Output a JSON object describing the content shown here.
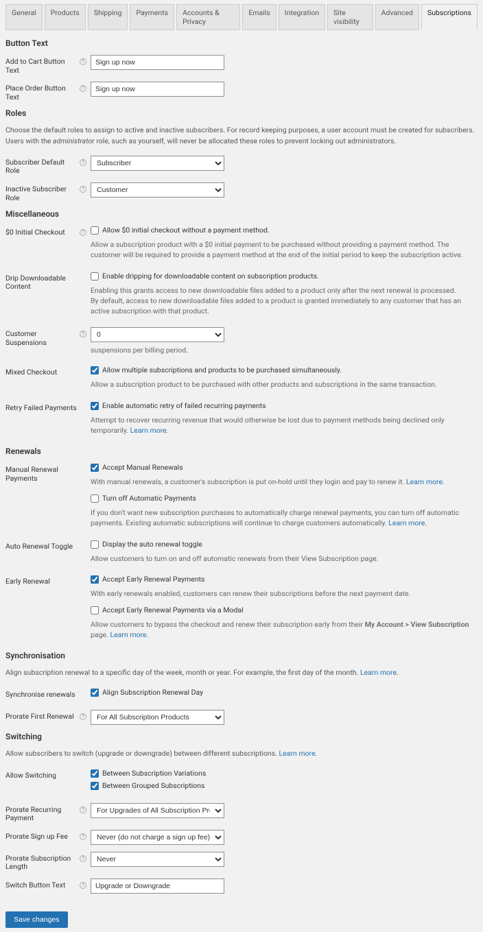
{
  "tabs": [
    "General",
    "Products",
    "Shipping",
    "Payments",
    "Accounts & Privacy",
    "Emails",
    "Integration",
    "Site visibility",
    "Advanced",
    "Subscriptions"
  ],
  "activeTab": "Subscriptions",
  "sections": {
    "buttonText": {
      "title": "Button Text",
      "addToCart": {
        "label": "Add to Cart Button Text",
        "value": "Sign up now"
      },
      "placeOrder": {
        "label": "Place Order Button Text",
        "value": "Sign up now"
      }
    },
    "roles": {
      "title": "Roles",
      "desc_a": "Choose the default roles to assign to active and inactive subscribers. For record keeping purposes, a user account must be created for subscribers. Users with the ",
      "desc_bold": "administrator",
      "desc_b": " role, such as yourself, will never be allocated these roles to prevent locking out administrators.",
      "defaultRole": {
        "label": "Subscriber Default Role",
        "value": "Subscriber"
      },
      "inactiveRole": {
        "label": "Inactive Subscriber Role",
        "value": "Customer"
      }
    },
    "misc": {
      "title": "Miscellaneous",
      "zeroInitial": {
        "label": "$0 Initial Checkout",
        "checkbox": "Allow $0 initial checkout without a payment method.",
        "help": "Allow a subscription product with a $0 initial payment to be purchased without providing a payment method. The customer will be required to provide a payment method at the end of the initial period to keep the subscription active."
      },
      "drip": {
        "label": "Drip Downloadable Content",
        "checkbox": "Enable dripping for downloadable content on subscription products.",
        "help1": "Enabling this grants access to new downloadable files added to a product only after the next renewal is processed.",
        "help2": "By default, access to new downloadable files added to a product is granted immediately to any customer that has an active subscription with that product."
      },
      "suspensions": {
        "label": "Customer Suspensions",
        "value": "0",
        "help": "suspensions per billing period."
      },
      "mixed": {
        "label": "Mixed Checkout",
        "checkbox": "Allow multiple subscriptions and products to be purchased simultaneously.",
        "help": "Allow a subscription product to be purchased with other products and subscriptions in the same transaction."
      },
      "retry": {
        "label": "Retry Failed Payments",
        "checkbox": "Enable automatic retry of failed recurring payments",
        "help": "Attempt to recover recurring revenue that would otherwise be lost due to payment methods being declined only temporarily. ",
        "learn": "Learn more"
      }
    },
    "renewals": {
      "title": "Renewals",
      "manual": {
        "label": "Manual Renewal Payments",
        "checkbox1": "Accept Manual Renewals",
        "help1": "With manual renewals, a customer's subscription is put on-hold until they login and pay to renew it. ",
        "learn1": "Learn more",
        "checkbox2": "Turn off Automatic Payments",
        "help2": "If you don't want new subscription purchases to automatically charge renewal payments, you can turn off automatic payments. Existing automatic subscriptions will continue to charge customers automatically. ",
        "learn2": "Learn more"
      },
      "autoToggle": {
        "label": "Auto Renewal Toggle",
        "checkbox": "Display the auto renewal toggle",
        "help": "Allow customers to turn on and off automatic renewals from their View Subscription page."
      },
      "early": {
        "label": "Early Renewal",
        "checkbox1": "Accept Early Renewal Payments",
        "help1": "With early renewals enabled, customers can renew their subscriptions before the next payment date.",
        "checkbox2": "Accept Early Renewal Payments via a Modal",
        "help2a": "Allow customers to bypass the checkout and renew their subscription early from their ",
        "help2bold": "My Account > View Subscription",
        "help2b": " page. ",
        "learn2": "Learn more"
      }
    },
    "sync": {
      "title": "Synchronisation",
      "desc": "Align subscription renewal to a specific day of the week, month or year. For example, the first day of the month. ",
      "learn": "Learn more",
      "syncRenewals": {
        "label": "Synchronise renewals",
        "checkbox": "Align Subscription Renewal Day"
      },
      "prorate": {
        "label": "Prorate First Renewal",
        "value": "For All Subscription Products"
      }
    },
    "switching": {
      "title": "Switching",
      "desc": "Allow subscribers to switch (upgrade or downgrade) between different subscriptions. ",
      "learn": "Learn more",
      "allow": {
        "label": "Allow Switching",
        "checkbox1": "Between Subscription Variations",
        "checkbox2": "Between Grouped Subscriptions"
      },
      "recurring": {
        "label": "Prorate Recurring Payment",
        "value": "For Upgrades of All Subscription Products"
      },
      "signupFee": {
        "label": "Prorate Sign up Fee",
        "value": "Never (do not charge a sign up fee)"
      },
      "subLength": {
        "label": "Prorate Subscription Length",
        "value": "Never"
      },
      "buttonText": {
        "label": "Switch Button Text",
        "value": "Upgrade or Downgrade"
      }
    }
  },
  "saveButton": "Save changes"
}
